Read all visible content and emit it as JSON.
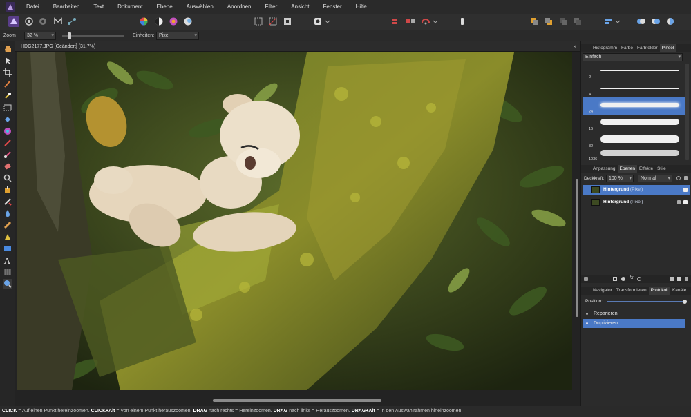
{
  "menu": [
    "Datei",
    "Bearbeiten",
    "Text",
    "Dokument",
    "Ebene",
    "Auswählen",
    "Anordnen",
    "Filter",
    "Ansicht",
    "Fenster",
    "Hilfe"
  ],
  "options": {
    "zoom_label": "Zoom",
    "zoom_value": "32 %",
    "units_label": "Einheiten:",
    "units_value": "Pixel"
  },
  "document": {
    "title": "HDG2177.JPG [Geändert] (31,7%)",
    "close": "×"
  },
  "brush_panel": {
    "tabs": [
      "Histogramm",
      "Farbe",
      "Farbfelder",
      "Pinsel"
    ],
    "active_tab": "Pinsel",
    "category": "Einfach",
    "brushes": [
      {
        "size": "2"
      },
      {
        "size": "4"
      },
      {
        "size": "24"
      },
      {
        "size": "16"
      },
      {
        "size": "32"
      },
      {
        "size": "1036"
      }
    ],
    "selected_index": 2
  },
  "layers_panel": {
    "tabs": [
      "Anpassung",
      "Ebenen",
      "Effekte",
      "Stile"
    ],
    "active_tab": "Ebenen",
    "opacity_label": "Deckkraft:",
    "opacity_value": "100 %",
    "blend_mode": "Normal",
    "layers": [
      {
        "name": "Hintergrund",
        "type": "(Pixel)"
      },
      {
        "name": "Hintergrund",
        "type": "(Pixel)"
      }
    ]
  },
  "history_panel": {
    "tabs": [
      "Navigator",
      "Transformieren",
      "Protokoll",
      "Kanäle"
    ],
    "active_tab": "Protokoll",
    "position_label": "Position:",
    "position_fraction": 1.0,
    "items": [
      "Reparieren",
      "Duplizieren"
    ]
  },
  "status": {
    "k1": "CLICK",
    "t1": " = Auf einen Punkt hereinzoomen. ",
    "k2": "CLICK+Alt",
    "t2": " = Von einem Punkt herauszoomen. ",
    "k3": "DRAG",
    "t3": " nach rechts = Hereinzoomen. ",
    "k4": "DRAG",
    "t4": " nach links = Herauszoomen. ",
    "k5": "DRAG+Alt",
    "t5": " = In den Auswahlrahmen hineinzoomen."
  },
  "colors": {
    "accent": "#4a79c6",
    "panel": "#2b2b2b",
    "canvas_bg": "#232323"
  }
}
